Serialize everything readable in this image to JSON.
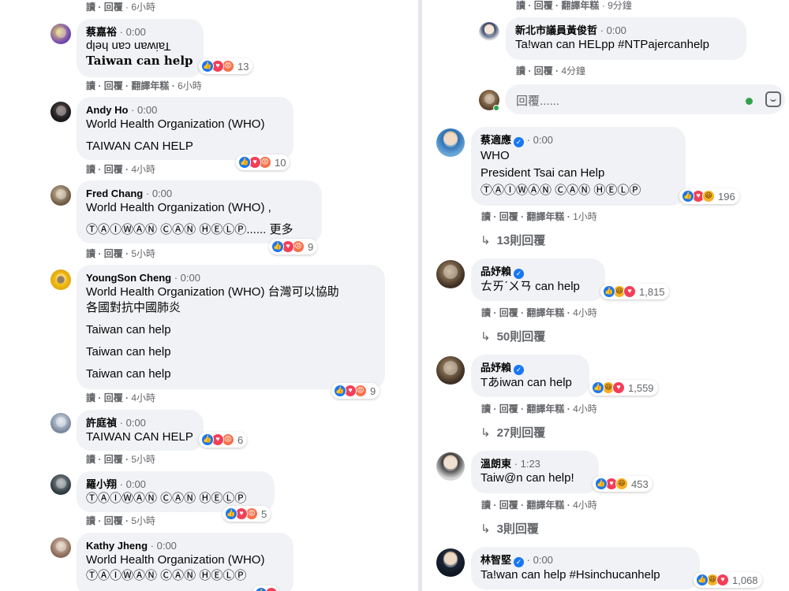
{
  "left": {
    "top_actions": {
      "read": "讀",
      "reply": "回覆",
      "time": "· 6小時"
    },
    "comments": [
      {
        "name": "蔡嘉裕",
        "dot": "·",
        "time": "0:00",
        "lines": [
          "Taiwan can help",
          "Taiwan can help"
        ],
        "reactions": {
          "count": "13"
        },
        "actions": {
          "read": "讀",
          "reply": "回覆",
          "translate": "翻譯年糕",
          "time": "6小時"
        }
      },
      {
        "name": "Andy Ho",
        "dot": "·",
        "time": "0:00",
        "lines": [
          "World Health Organization (WHO)",
          "TAIWAN CAN HELP"
        ],
        "reactions": {
          "count": "10"
        },
        "actions": {
          "read": "讀",
          "reply": "回覆",
          "time": "4小時"
        }
      },
      {
        "name": "Fred Chang",
        "dot": "·",
        "time": "0:00",
        "lines": [
          "World Health Organization (WHO) ,",
          "ⓉⒶⒾⓌⒶⓃ ⒸⒶⓃ ⒽⒺⓁⓅ......"
        ],
        "more": "更多",
        "reactions": {
          "count": "9"
        },
        "actions": {
          "read": "讀",
          "reply": "回覆",
          "time": "5小時"
        }
      },
      {
        "name": "YoungSon Cheng",
        "dot": "·",
        "time": "0:00",
        "lines": [
          "World Health Organization (WHO) 台灣可以協助",
          "各國對抗中國肺炎",
          "Taiwan can help",
          "Taiwan can help",
          "Taiwan can help"
        ],
        "reactions": {
          "count": "9"
        },
        "actions": {
          "read": "讀",
          "reply": "回覆",
          "time": "4小時"
        }
      },
      {
        "name": "許庭禎",
        "dot": "·",
        "time": "0:00",
        "lines": [
          "TAIWAN CAN HELP"
        ],
        "reactions": {
          "count": "6"
        },
        "actions": {
          "read": "讀",
          "reply": "回覆",
          "time": "5小時"
        }
      },
      {
        "name": "羅小翔",
        "dot": "·",
        "time": "0:00",
        "lines": [
          "ⓉⒶⒾⓌⒶⓃ ⒸⒶⓃ ⒽⒺⓁⓅ"
        ],
        "reactions": {
          "count": "5"
        },
        "actions": {
          "read": "讀",
          "reply": "回覆",
          "time": "5小時"
        }
      },
      {
        "name": "Kathy Jheng",
        "dot": "·",
        "time": "0:00",
        "lines": [
          "World Health Organization (WHO)",
          "ⓉⒶⒾⓌⒶⓃ ⒸⒶⓃ ⒽⒺⓁⓅ"
        ],
        "actions": {}
      }
    ]
  },
  "right": {
    "top_actions": {
      "read": "讀",
      "reply": "回覆",
      "translate": "翻譯年糕",
      "time": "· 9分鐘"
    },
    "councilor": {
      "name": "新北市議員黃俊哲",
      "dot": "·",
      "time": "0:00",
      "line": "Ta!wan can HELpp #NTPajercanhelp",
      "actions": {
        "read": "讀",
        "reply": "回覆",
        "time": "4分鐘"
      }
    },
    "reply_box": {
      "placeholder": "回覆......"
    },
    "comments": [
      {
        "name": "蔡適應",
        "dot": "·",
        "time": "0:00",
        "lines": [
          "WHO",
          "President Tsai can Help",
          "ⓉⒶⒾⓌⒶⓃ ⒸⒶⓃ ⒽⒺⓁⓅ"
        ],
        "reactions": {
          "count": "196"
        },
        "actions": {
          "read": "讀",
          "reply": "回覆",
          "translate": "翻譯年糕",
          "time": "1小時"
        },
        "replies": "13則回覆"
      },
      {
        "name": "品妤賴",
        "lines": [
          "ㄊㄞˊㄨㄢ can help"
        ],
        "reactions": {
          "count": "1,815"
        },
        "actions": {
          "read": "讀",
          "reply": "回覆",
          "translate": "翻譯年糕",
          "time": "4小時"
        },
        "replies": "50則回覆"
      },
      {
        "name": "品妤賴",
        "lines": [
          "Tあiwan can help"
        ],
        "reactions": {
          "count": "1,559"
        },
        "actions": {
          "read": "讀",
          "reply": "回覆",
          "translate": "翻譯年糕",
          "time": "4小時"
        },
        "replies": "27則回覆"
      },
      {
        "name": "溫朗東",
        "dot": "·",
        "time": "1:23",
        "lines": [
          "Taiw@n can help!"
        ],
        "reactions": {
          "count": "453"
        },
        "actions": {
          "read": "讀",
          "reply": "回覆",
          "translate": "翻譯年糕",
          "time": "4小時"
        },
        "replies": "3則回覆"
      },
      {
        "name": "林智堅",
        "dot": "·",
        "time": "0:00",
        "lines": [
          "Ta!wan can help #Hsinchucanhelp"
        ],
        "reactions": {
          "count": "1,068"
        }
      }
    ]
  },
  "colors": {
    "bubble": "#f0f2f5",
    "secondary_text": "#65676b",
    "like": "#1877f2",
    "love": "#f33e58",
    "angry": "#f7714b",
    "haha": "#f7b125",
    "online": "#31a24c"
  },
  "icons": [
    "like-icon",
    "love-icon",
    "angry-icon",
    "haha-icon",
    "verified-icon",
    "reply-arrow-icon",
    "sticker-icon",
    "online-dot-icon"
  ]
}
